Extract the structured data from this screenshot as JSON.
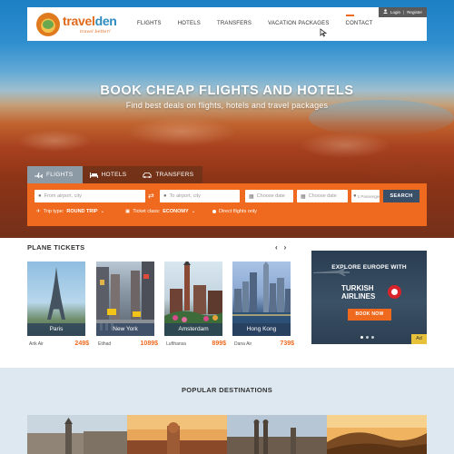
{
  "brand": {
    "name_a": "travel",
    "name_b": "den",
    "tagline": "travel better!"
  },
  "nav": {
    "links": [
      "FLIGHTS",
      "HOTELS",
      "TRANSFERS",
      "VACATION PACKAGES",
      "CONTACT"
    ],
    "active": "CONTACT",
    "login": "Login",
    "separator": "|",
    "register": "Register"
  },
  "hero": {
    "title": "BOOK CHEAP FLIGHTS AND HOTELS",
    "subtitle": "Find best deals on flights, hotels and travel packages"
  },
  "search": {
    "tabs": [
      "FLIGHTS",
      "HOTELS",
      "TRANSFERS"
    ],
    "active_tab": "FLIGHTS",
    "from_placeholder": "From airport, city",
    "to_placeholder": "To airport, city",
    "depart_placeholder": "Choose date",
    "return_placeholder": "Choose date",
    "passengers": "1 Passenger",
    "button": "SEARCH",
    "trip_type_label": "Trip type:",
    "trip_type_value": "ROUND TRIP",
    "class_label": "Ticket class:",
    "class_value": "ECONOMY",
    "direct_label": "Direct flights only"
  },
  "tickets": {
    "title": "PLANE TICKETS",
    "prev": "‹",
    "next": "›",
    "cards": [
      {
        "city": "Paris",
        "airline": "Arik Air",
        "price": "249$"
      },
      {
        "city": "New York",
        "airline": "Etihad",
        "price": "1089$"
      },
      {
        "city": "Amsterdam",
        "airline": "Lufthansa",
        "price": "899$"
      },
      {
        "city": "Hong Kong",
        "airline": "Dana Air",
        "price": "739$"
      }
    ]
  },
  "ad": {
    "headline": "EXPLORE EUROPE WITH",
    "brand_line1": "TURKISH",
    "brand_line2": "AIRLINES",
    "button": "BOOK NOW",
    "badge": "Ad",
    "slides": 3,
    "active_slide": 1
  },
  "popular": {
    "title": "POPULAR DESTINATIONS"
  },
  "colors": {
    "accent": "#ef6a1e",
    "navy": "#3a4f68",
    "tab_active": "#8c9aa6"
  },
  "icons": [
    "user-icon",
    "plane-icon",
    "bed-icon",
    "car-icon",
    "location-icon",
    "swap-icon",
    "calendar-icon",
    "chevron-down-icon",
    "cursor-icon"
  ]
}
